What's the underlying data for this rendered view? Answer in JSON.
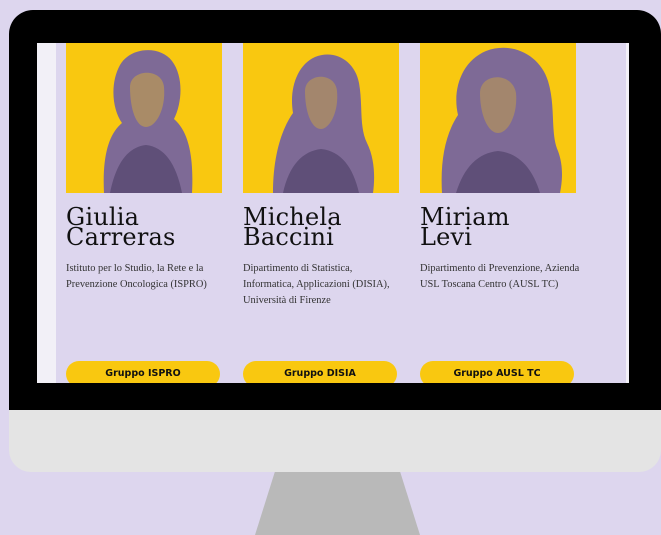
{
  "people": [
    {
      "name_line1": "Giulia",
      "name_line2": "Carreras",
      "affiliation": "Istituto per lo Studio, la Rete e la Prevenzione Oncologica (ISPRO)",
      "button": "Gruppo ISPRO"
    },
    {
      "name_line1": "Michela",
      "name_line2": "Baccini",
      "affiliation": "Dipartimento di Statistica, Informatica, Applicazioni (DISIA), Università di Firenze",
      "button": "Gruppo DISIA"
    },
    {
      "name_line1": "Miriam",
      "name_line2": "Levi",
      "affiliation": "Dipartimento di Prevenzione, Azienda USL Toscana Centro (AUSL TC)",
      "button": "Gruppo AUSL TC"
    }
  ],
  "colors": {
    "accent": "#f9c810",
    "portrait": "#7e6a96",
    "background": "#ddd6ee"
  }
}
